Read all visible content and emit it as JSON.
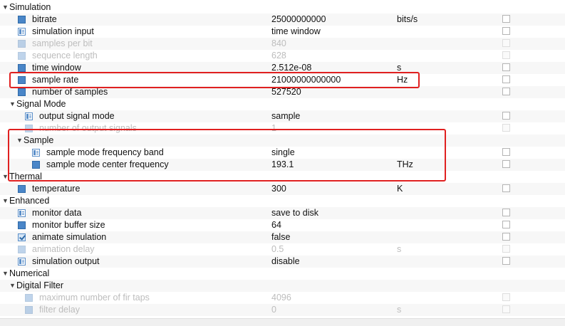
{
  "rows": [
    {
      "type": "group",
      "label": "Simulation",
      "expanded": true
    },
    {
      "type": "param",
      "label": "bitrate",
      "value": "25000000000",
      "unit": "bits/s",
      "icon": "param-icon",
      "disabled": false
    },
    {
      "type": "param",
      "label": "simulation input",
      "value": "time window",
      "unit": "",
      "icon": "list-icon",
      "disabled": false
    },
    {
      "type": "param",
      "label": "samples per bit",
      "value": "840",
      "unit": "",
      "icon": "param-icon",
      "disabled": true
    },
    {
      "type": "param",
      "label": "sequence length",
      "value": "628",
      "unit": "",
      "icon": "param-icon",
      "disabled": true
    },
    {
      "type": "param",
      "label": "time window",
      "value": "2.512e-08",
      "unit": "s",
      "icon": "param-icon",
      "disabled": false
    },
    {
      "type": "param",
      "label": "sample rate",
      "value": "21000000000000",
      "unit": "Hz",
      "icon": "param-icon",
      "disabled": false
    },
    {
      "type": "param",
      "label": "number of samples",
      "value": "527520",
      "unit": "",
      "icon": "param-icon",
      "disabled": false
    },
    {
      "type": "group",
      "label": "Signal Mode",
      "expanded": true
    },
    {
      "type": "param",
      "label": "output signal mode",
      "value": "sample",
      "unit": "",
      "icon": "list-icon",
      "disabled": false
    },
    {
      "type": "param",
      "label": "number of output signals",
      "value": "1",
      "unit": "",
      "icon": "param-icon",
      "disabled": true
    },
    {
      "type": "group",
      "label": "Sample",
      "expanded": true
    },
    {
      "type": "param",
      "label": "sample mode frequency band",
      "value": "single",
      "unit": "",
      "icon": "list-icon",
      "disabled": false
    },
    {
      "type": "param",
      "label": "sample mode center frequency",
      "value": "193.1",
      "unit": "THz",
      "icon": "param-icon",
      "disabled": false
    },
    {
      "type": "group",
      "label": "Thermal",
      "expanded": true
    },
    {
      "type": "param",
      "label": "temperature",
      "value": "300",
      "unit": "K",
      "icon": "param-icon",
      "disabled": false
    },
    {
      "type": "group",
      "label": "Enhanced",
      "expanded": true
    },
    {
      "type": "param",
      "label": "monitor data",
      "value": "save to disk",
      "unit": "",
      "icon": "list-icon",
      "disabled": false
    },
    {
      "type": "param",
      "label": "monitor buffer size",
      "value": "64",
      "unit": "",
      "icon": "param-icon",
      "disabled": false
    },
    {
      "type": "param",
      "label": "animate simulation",
      "value": "false",
      "unit": "",
      "icon": "checkbox-icon",
      "disabled": false
    },
    {
      "type": "param",
      "label": "animation delay",
      "value": "0.5",
      "unit": "s",
      "icon": "param-icon",
      "disabled": true
    },
    {
      "type": "param",
      "label": "simulation output",
      "value": "disable",
      "unit": "",
      "icon": "list-icon",
      "disabled": false
    },
    {
      "type": "group",
      "label": "Numerical",
      "expanded": true
    },
    {
      "type": "group",
      "label": "Digital Filter",
      "expanded": true
    },
    {
      "type": "param",
      "label": "maximum number of fir taps",
      "value": "4096",
      "unit": "",
      "icon": "param-icon",
      "disabled": true
    },
    {
      "type": "param",
      "label": "filter delay",
      "value": "0",
      "unit": "s",
      "icon": "param-icon",
      "disabled": true
    }
  ],
  "colors": {
    "highlight": "#e02020",
    "icon": "#4a86c8",
    "disabled_text": "#bdbdbd"
  }
}
